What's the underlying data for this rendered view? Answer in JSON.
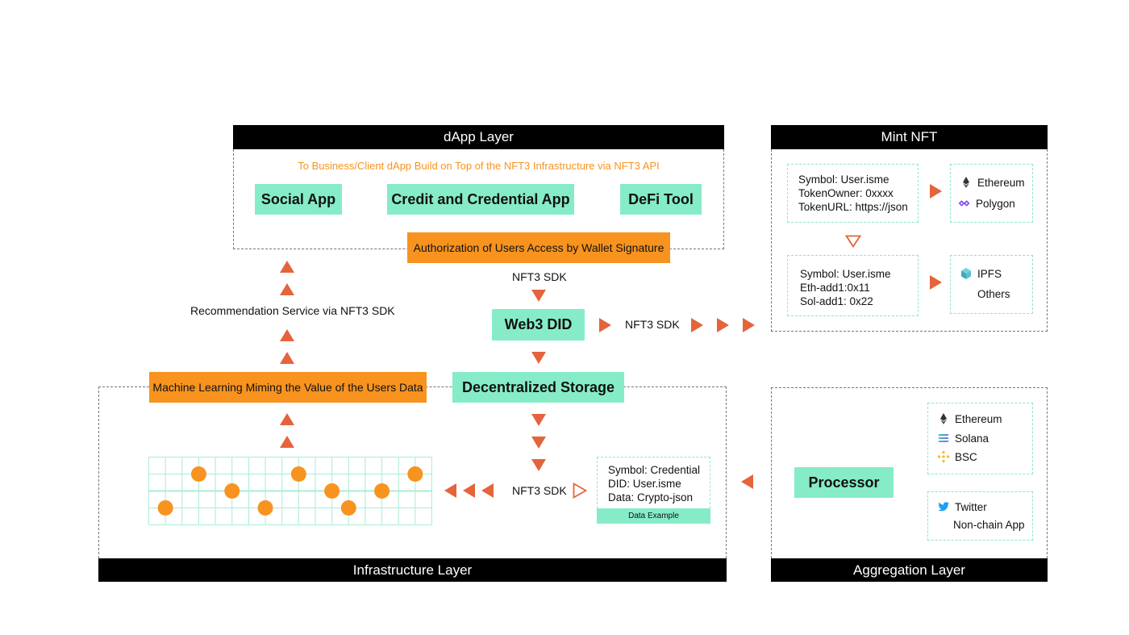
{
  "colors": {
    "green": "#86ecc8",
    "orange": "#f7931e",
    "arrow": "#e4643c",
    "header": "#000000",
    "subtitle": "#f7931e"
  },
  "dapp_layer": {
    "title": "dApp Layer",
    "subtitle": "To Business/Client dApp Build on Top of the NFT3 Infrastructure via NFT3 API",
    "apps": [
      "Social App",
      "Credit and Credential App",
      "DeFi Tool"
    ],
    "authorization": "Authorization of Users Access by Wallet Signature"
  },
  "middle": {
    "sdk_top": "NFT3 SDK",
    "web3_did": "Web3 DID",
    "sdk_right": "NFT3 SDK",
    "recommendation": "Recommendation Service via NFT3 SDK"
  },
  "mint_nft": {
    "title": "Mint NFT",
    "box1": [
      "Symbol: User.isme",
      "TokenOwner: 0xxxx",
      "TokenURL: https://json"
    ],
    "chains1": [
      {
        "icon": "ethereum-icon",
        "label": "Ethereum"
      },
      {
        "icon": "polygon-icon",
        "label": "Polygon"
      }
    ],
    "box2": [
      "Symbol: User.isme",
      "Eth-add1:0x11",
      "Sol-add1: 0x22"
    ],
    "chains2": [
      {
        "icon": "ipfs-icon",
        "label": "IPFS"
      },
      {
        "icon": "",
        "label": "Others"
      }
    ]
  },
  "infrastructure_layer": {
    "title": "Infrastructure Layer",
    "ml": "Machine Learning Miming the Value of the Users Data",
    "storage": "Decentralized Storage",
    "sdk": "NFT3 SDK",
    "data_example": {
      "lines": [
        "Symbol: Credential",
        "DID: User.isme",
        "Data: Crypto-json"
      ],
      "caption": "Data Example"
    }
  },
  "aggregation_layer": {
    "title": "Aggregation Layer",
    "processor": "Processor",
    "chains": [
      {
        "icon": "ethereum-icon",
        "label": "Ethereum"
      },
      {
        "icon": "solana-icon",
        "label": "Solana"
      },
      {
        "icon": "bsc-icon",
        "label": "BSC"
      }
    ],
    "apps": [
      {
        "icon": "twitter-icon",
        "label": "Twitter"
      },
      {
        "icon": "",
        "label": "Non-chain App"
      }
    ]
  }
}
